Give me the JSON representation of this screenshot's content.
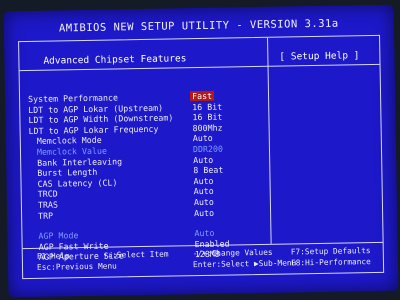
{
  "title": "AMIBIOS NEW SETUP UTILITY - VERSION 3.31a",
  "section_title": "Advanced Chipset Features",
  "help_title": "[ Setup Help ]",
  "settings": [
    {
      "label": "System Performance",
      "value": "Fast",
      "selected": true
    },
    {
      "label": "LDT to AGP Lokar (Upstream)",
      "value": "16 Bit"
    },
    {
      "label": "LDT to AGP Width (Downstream)",
      "value": "16 Bit"
    },
    {
      "label": "LDT to AGP Lokar Frequency",
      "value": "800Mhz"
    },
    {
      "label": "Memclock Mode",
      "value": "Auto"
    },
    {
      "label": "Memclock Value",
      "value": "DDR200",
      "disabled": true
    },
    {
      "label": "Bank Interleaving",
      "value": "Auto"
    },
    {
      "label": "Burst Length",
      "value": "8 Beat"
    },
    {
      "label": "CAS Latency (CL)",
      "value": "Auto"
    },
    {
      "label": "TRCD",
      "value": "Auto"
    },
    {
      "label": "TRAS",
      "value": "Auto"
    },
    {
      "label": "TRP",
      "value": "Auto"
    },
    {
      "label": "AGP Mode",
      "value": "Auto",
      "disabled": true
    },
    {
      "label": "AGP Fast Write",
      "value": "Enabled"
    },
    {
      "label": "AGP Aperture Size",
      "value": "128MB"
    }
  ],
  "footer": {
    "f1_key": "F1:Help",
    "select_item": "↑↓:Select Item",
    "change_values": "-/+:Change Values",
    "f7": "F7:Setup Defaults",
    "esc": "Esc:Previous Menu",
    "enter": "Enter:Select ▶Sub-Menu",
    "f8": "F8:Hi-Performance"
  },
  "colors": {
    "background": "#1d18c9",
    "text": "#ececf5",
    "highlight": "#b11a1a",
    "disabled": "#7f9cff"
  }
}
